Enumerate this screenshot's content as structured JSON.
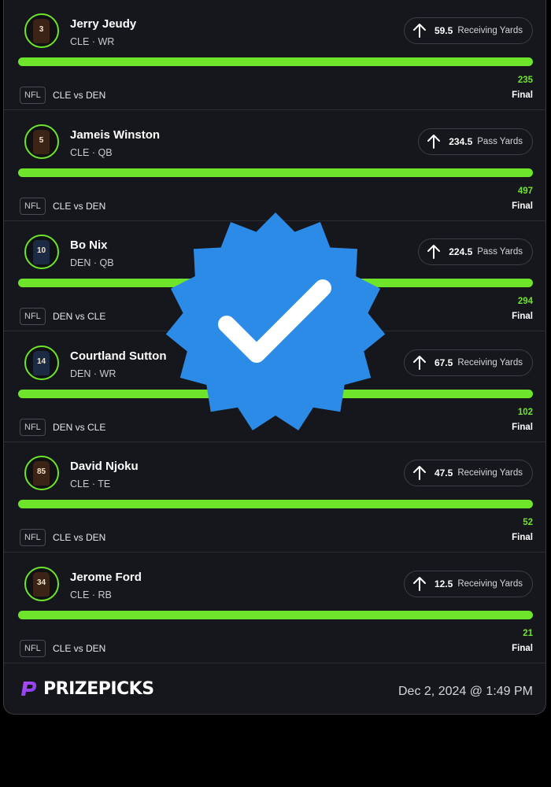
{
  "picks": [
    {
      "name": "Jerry Jeudy",
      "team": "CLE",
      "position": "WR",
      "jersey": "3",
      "jersey_color": "#3b2416",
      "line": "59.5",
      "stat": "Receiving Yards",
      "league": "NFL",
      "matchup": "CLE vs DEN",
      "actual": "235",
      "status": "Final"
    },
    {
      "name": "Jameis Winston",
      "team": "CLE",
      "position": "QB",
      "jersey": "5",
      "jersey_color": "#3b2416",
      "line": "234.5",
      "stat": "Pass Yards",
      "league": "NFL",
      "matchup": "CLE vs DEN",
      "actual": "497",
      "status": "Final"
    },
    {
      "name": "Bo Nix",
      "team": "DEN",
      "position": "QB",
      "jersey": "10",
      "jersey_color": "#1d2a44",
      "line": "224.5",
      "stat": "Pass Yards",
      "league": "NFL",
      "matchup": "DEN vs CLE",
      "actual": "294",
      "status": "Final"
    },
    {
      "name": "Courtland Sutton",
      "team": "DEN",
      "position": "WR",
      "jersey": "14",
      "jersey_color": "#1d2a44",
      "line": "67.5",
      "stat": "Receiving Yards",
      "league": "NFL",
      "matchup": "DEN vs CLE",
      "actual": "102",
      "status": "Final"
    },
    {
      "name": "David Njoku",
      "team": "CLE",
      "position": "TE",
      "jersey": "85",
      "jersey_color": "#3b2416",
      "line": "47.5",
      "stat": "Receiving Yards",
      "league": "NFL",
      "matchup": "CLE vs DEN",
      "actual": "52",
      "status": "Final"
    },
    {
      "name": "Jerome Ford",
      "team": "CLE",
      "position": "RB",
      "jersey": "34",
      "jersey_color": "#3b2416",
      "line": "12.5",
      "stat": "Receiving Yards",
      "league": "NFL",
      "matchup": "CLE vs DEN",
      "actual": "21",
      "status": "Final"
    }
  ],
  "team_separator": "·",
  "direction_icon": "arrow-up-icon",
  "footer": {
    "brand": "PRIZEPICKS",
    "timestamp": "Dec 2, 2024 @ 1:49 PM"
  },
  "colors": {
    "accent": "#6ee42a",
    "badge": "#2d8be8",
    "background": "#16171c"
  }
}
